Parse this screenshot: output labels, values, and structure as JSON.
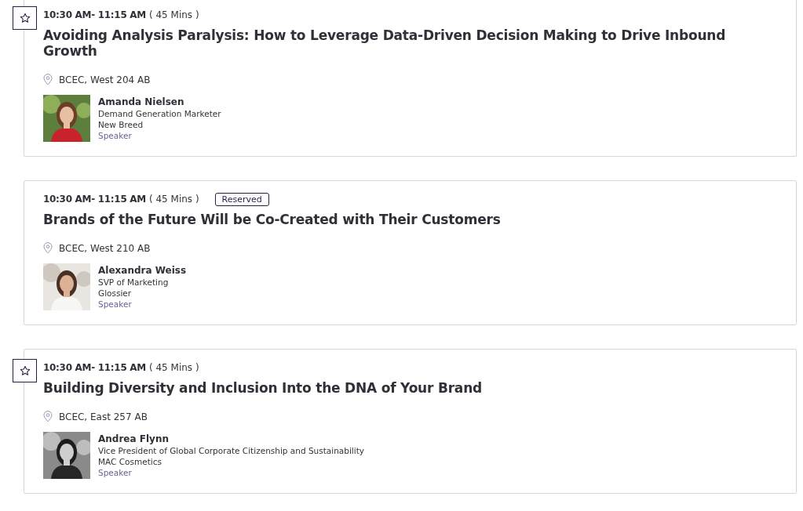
{
  "sessions": [
    {
      "starrable": true,
      "starred": false,
      "time": "10:30 AM- 11:15 AM",
      "duration": "( 45 Mins )",
      "title": "Avoiding Analysis Paralysis: How to Leverage Data-Driven Decision Making to Drive Inbound Growth",
      "location": "BCEC, West 204 AB",
      "speaker": {
        "name": "Amanda Nielsen",
        "job": "Demand Generation Marketer",
        "company": "New Breed",
        "role": "Speaker"
      }
    },
    {
      "starrable": false,
      "time": "10:30 AM- 11:15 AM",
      "duration": "( 45 Mins )",
      "badge": "Reserved",
      "title": "Brands of the Future Will be Co-Created with Their Customers",
      "location": "BCEC, West 210 AB",
      "speaker": {
        "name": "Alexandra Weiss",
        "job": "SVP of Marketing",
        "company": "Glossier",
        "role": "Speaker"
      }
    },
    {
      "starrable": true,
      "starred": false,
      "time": "10:30 AM- 11:15 AM",
      "duration": "( 45 Mins )",
      "title": "Building Diversity and Inclusion Into the DNA of Your Brand",
      "location": "BCEC, East 257 AB",
      "speaker": {
        "name": "Andrea Flynn",
        "job": "Vice President of Global Corporate Citizenship and Sustainability",
        "company": "MAC Cosmetics",
        "role": "Speaker"
      }
    }
  ]
}
